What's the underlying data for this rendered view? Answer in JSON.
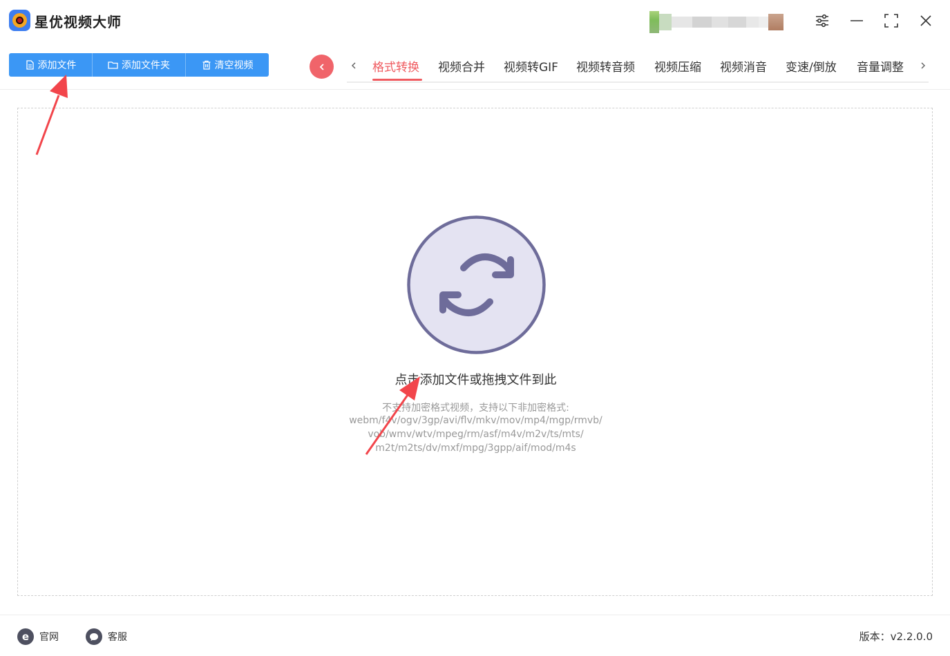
{
  "app": {
    "title": "星优视频大师"
  },
  "toolbar": {
    "add_file": "添加文件",
    "add_folder": "添加文件夹",
    "clear_video": "清空视频"
  },
  "tabs": [
    {
      "label": "格式转换",
      "active": true
    },
    {
      "label": "视频合并",
      "active": false
    },
    {
      "label": "视频转GIF",
      "active": false
    },
    {
      "label": "视频转音频",
      "active": false
    },
    {
      "label": "视频压缩",
      "active": false
    },
    {
      "label": "视频消音",
      "active": false
    },
    {
      "label": "变速/倒放",
      "active": false
    },
    {
      "label": "音量调整",
      "active": false
    }
  ],
  "dropzone": {
    "main_text": "点击添加文件或拖拽文件到此",
    "sub_lines": [
      "不支持加密格式视频，支持以下非加密格式:",
      "webm/f4v/ogv/3gp/avi/flv/mkv/mov/mp4/mgp/rmvb/",
      "vob/wmv/wtv/mpeg/rm/asf/m4v/m2v/ts/mts/",
      "m2t/m2ts/dv/mxf/mpg/3gpp/aif/mod/m4s"
    ]
  },
  "footer": {
    "website": "官网",
    "support": "客服",
    "version": "版本：v2.2.0.0"
  },
  "colors": {
    "primary": "#3b97f5",
    "accent": "#ef5a5f",
    "annotation_arrow": "#f2454b",
    "drop_icon_fill": "#e4e3f2",
    "drop_icon_stroke": "#6e6c9a"
  }
}
